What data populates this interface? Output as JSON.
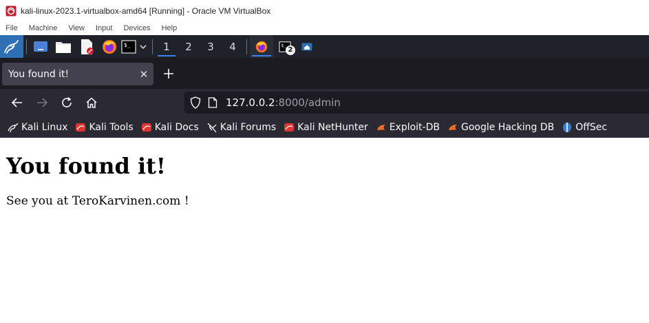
{
  "vbox": {
    "title": "kali-linux-2023.1-virtualbox-amd64 [Running] - Oracle VM VirtualBox",
    "menu": [
      "File",
      "Machine",
      "View",
      "Input",
      "Devices",
      "Help"
    ]
  },
  "taskbar": {
    "workspaces": [
      "1",
      "2",
      "3",
      "4"
    ],
    "terminal_badge": "2"
  },
  "browser": {
    "tab_title": "You found it!",
    "url_host": "127.0.0.2",
    "url_path": ":8000/admin",
    "bookmarks": [
      {
        "label": "Kali Linux",
        "icon": "kali-dragon-icon"
      },
      {
        "label": "Kali Tools",
        "icon": "kali-tools-icon"
      },
      {
        "label": "Kali Docs",
        "icon": "kali-docs-icon"
      },
      {
        "label": "Kali Forums",
        "icon": "kali-forums-icon"
      },
      {
        "label": "Kali NetHunter",
        "icon": "kali-nethunter-icon"
      },
      {
        "label": "Exploit-DB",
        "icon": "exploit-db-icon"
      },
      {
        "label": "Google Hacking DB",
        "icon": "ghdb-icon"
      },
      {
        "label": "OffSec",
        "icon": "offsec-icon"
      }
    ]
  },
  "page": {
    "heading": "You found it!",
    "text": "See you at TeroKarvinen.com !"
  },
  "colors": {
    "taskbar_bg": "#1f2229",
    "tabstrip_bg": "#1c1b22",
    "toolbar_bg": "#2b2a33",
    "accent": "#3b82f6"
  }
}
